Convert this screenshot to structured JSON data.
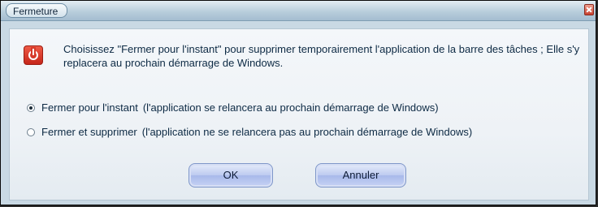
{
  "window": {
    "title": "Fermeture",
    "close_icon": "close-icon"
  },
  "message": {
    "icon": "power-icon",
    "text": "Choisissez  \"Fermer pour l'instant\" pour supprimer temporairement l'application de la barre des tâches ;  Elle s'y replacera au prochain démarrage de Windows."
  },
  "options": [
    {
      "label": "Fermer pour l'instant",
      "description": "(l'application se relancera au prochain démarrage de Windows)",
      "selected": true
    },
    {
      "label": "Fermer et supprimer",
      "description": "(l'application ne se relancera pas au prochain démarrage de Windows)",
      "selected": false
    }
  ],
  "buttons": {
    "ok_label": "OK",
    "cancel_label": "Annuler"
  },
  "colors": {
    "accent_red": "#d63a2a",
    "button_blue": "#bccaf0"
  }
}
